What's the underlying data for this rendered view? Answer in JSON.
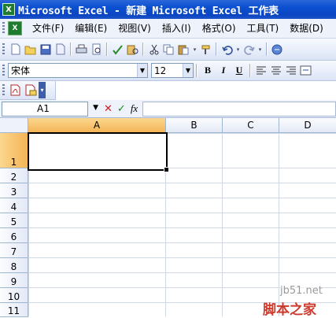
{
  "window": {
    "title": "Microsoft Excel - 新建 Microsoft Excel 工作表"
  },
  "menu": [
    "文件(F)",
    "编辑(E)",
    "视图(V)",
    "插入(I)",
    "格式(O)",
    "工具(T)",
    "数据(D)"
  ],
  "toolbar_format": {
    "font_name": "宋体",
    "font_size": "12",
    "bold": "B",
    "italic": "I",
    "underline": "U"
  },
  "formula_bar": {
    "name_box": "A1",
    "cancel": "✕",
    "enter": "✓",
    "fx": "fx",
    "value": ""
  },
  "sheet": {
    "columns": [
      "A",
      "B",
      "C",
      "D"
    ],
    "rows": [
      "1",
      "2",
      "3",
      "4",
      "5",
      "6",
      "7",
      "8",
      "9",
      "10",
      "11"
    ],
    "active_cell": "A1"
  },
  "watermark": {
    "site": "jb51.net",
    "brand": "脚本之家"
  },
  "colors": {
    "title_bar": "#0a4fd0",
    "selected_header": "#f4b456",
    "grid_line": "#d0d7e5"
  }
}
